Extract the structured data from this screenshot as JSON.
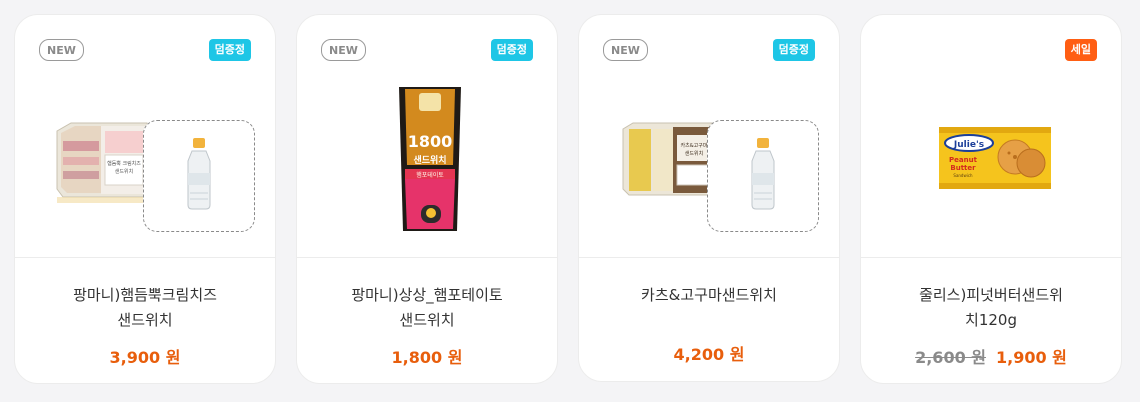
{
  "colors": {
    "accent_price": "#e85e0c",
    "tag_gift": "#1ec6e6",
    "tag_sale": "#ff5e13"
  },
  "cards": [
    {
      "new_label": "NEW",
      "tag_label": "덤증정",
      "tag_color": "#1ec6e6",
      "name_line1": "팡마니)햄듬뿍크림치즈",
      "name_line2": "샌드위치",
      "price": "3,900 원"
    },
    {
      "new_label": "NEW",
      "tag_label": "덤증정",
      "tag_color": "#1ec6e6",
      "name_line1": "팡마니)상상_햄포테이토",
      "name_line2": "샌드위치",
      "price": "1,800 원"
    },
    {
      "new_label": "NEW",
      "tag_label": "덤증정",
      "tag_color": "#1ec6e6",
      "name_line1": "카츠&고구마샌드위치",
      "name_line2": "",
      "price": "4,200 원"
    },
    {
      "new_label": "",
      "tag_label": "세일",
      "tag_color": "#ff5e13",
      "name_line1": "줄리스)피넛버터샌드위",
      "name_line2": "치120g",
      "old_price": "2,600 원",
      "price": "1,900 원"
    }
  ],
  "images": {
    "card1_pack_text": [
      "햄듬뿍 크림치즈",
      "샌드위치"
    ],
    "card2_pack_top": "1800",
    "card2_pack_label": "샌드위치",
    "card2_pack_sub": "햄포테이토",
    "card3_pack_text": [
      "카츠&고구마",
      "샌드위치"
    ],
    "card4_brand": "Julie's",
    "card4_product": [
      "Peanut",
      "Butter",
      "Sandwich"
    ]
  }
}
